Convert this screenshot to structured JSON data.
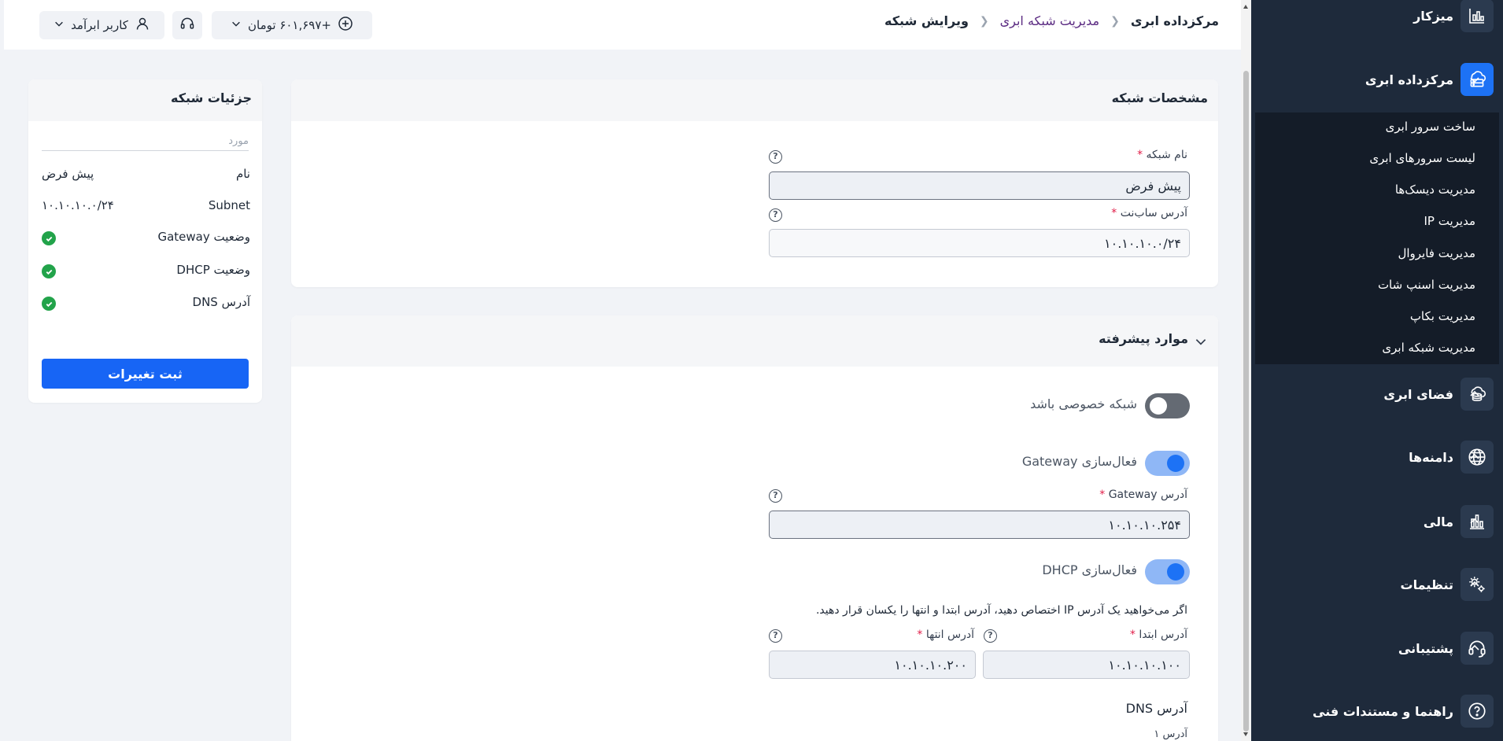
{
  "sidebar": {
    "items": [
      {
        "label": "میزکار",
        "icon": "dashboard-chart-icon"
      },
      {
        "label": "مرکزداده ابری",
        "icon": "datacenter-icon",
        "active": true,
        "expanded": true
      },
      {
        "label": "فضای ابری",
        "icon": "cloud-storage-icon"
      },
      {
        "label": "دامنه‌ها",
        "icon": "globe-icon"
      },
      {
        "label": "مالی",
        "icon": "finance-bars-icon"
      },
      {
        "label": "تنظیمات",
        "icon": "gears-icon"
      },
      {
        "label": "پشتیبانی",
        "icon": "headset-icon"
      },
      {
        "label": "راهنما و مستندات فنی",
        "icon": "help-icon"
      }
    ],
    "submenu": [
      "ساخت سرور ابری",
      "لیست سرورهای ابری",
      "مدیریت دیسک‌ها",
      "مدیریت IP",
      "مدیریت فایروال",
      "مدیریت اسنپ شات",
      "مدیریت بکاپ",
      "مدیریت شبکه ابری"
    ]
  },
  "breadcrumb": {
    "home": "مرکزداده ابری",
    "section": "مدیریت شبکه ابری",
    "current": "ویرایش شبکه"
  },
  "topbar": {
    "balance": "+۶۰۱,۶۹۷ تومان",
    "user": "کاربر ابرآمد"
  },
  "network_spec": {
    "title": "مشخصات شبکه",
    "name_label": "نام شبکه",
    "name_value": "پیش فرض",
    "subnet_label": "آدرس ساب‌نت",
    "subnet_value": "۱۰.۱۰.۱۰.۰/۲۴"
  },
  "advanced": {
    "title": "موارد پیشرفته",
    "private_label": "شبکه خصوصی باشد",
    "private_on": false,
    "gateway_toggle_label": "فعال‌سازی Gateway",
    "gateway_on": true,
    "gateway_label": "آدرس Gateway",
    "gateway_value": "۱۰.۱۰.۱۰.۲۵۴",
    "dhcp_toggle_label": "فعال‌سازی DHCP",
    "dhcp_on": true,
    "dhcp_hint": "اگر می‌خواهید یک آدرس IP اختصاص دهید، آدرس ابتدا و انتها را یکسان قرار دهید.",
    "start_label": "آدرس ابتدا",
    "start_value": "۱۰.۱۰.۱۰.۱۰۰",
    "end_label": "آدرس انتها",
    "end_value": "۱۰.۱۰.۱۰.۲۰۰",
    "dns_title": "آدرس DNS",
    "dns_1_label": "آدرس ۱"
  },
  "details": {
    "title": "جزئیات شبکه",
    "header": "مورد",
    "rows": [
      {
        "key": "نام",
        "value": "پیش فرض"
      },
      {
        "key": "Subnet",
        "value": "۱۰.۱۰.۱۰.۰/۲۴"
      },
      {
        "key": "وضعیت Gateway",
        "status": "ok"
      },
      {
        "key": "وضعیت DHCP",
        "status": "ok"
      },
      {
        "key": "آدرس DNS",
        "status": "ok"
      }
    ],
    "save_label": "ثبت تغییرات"
  },
  "colors": {
    "accent": "#1765f5",
    "sidebar": "#1e2a3b",
    "success": "#22a34a",
    "required": "#e11d48",
    "link": "#5b2b82"
  }
}
